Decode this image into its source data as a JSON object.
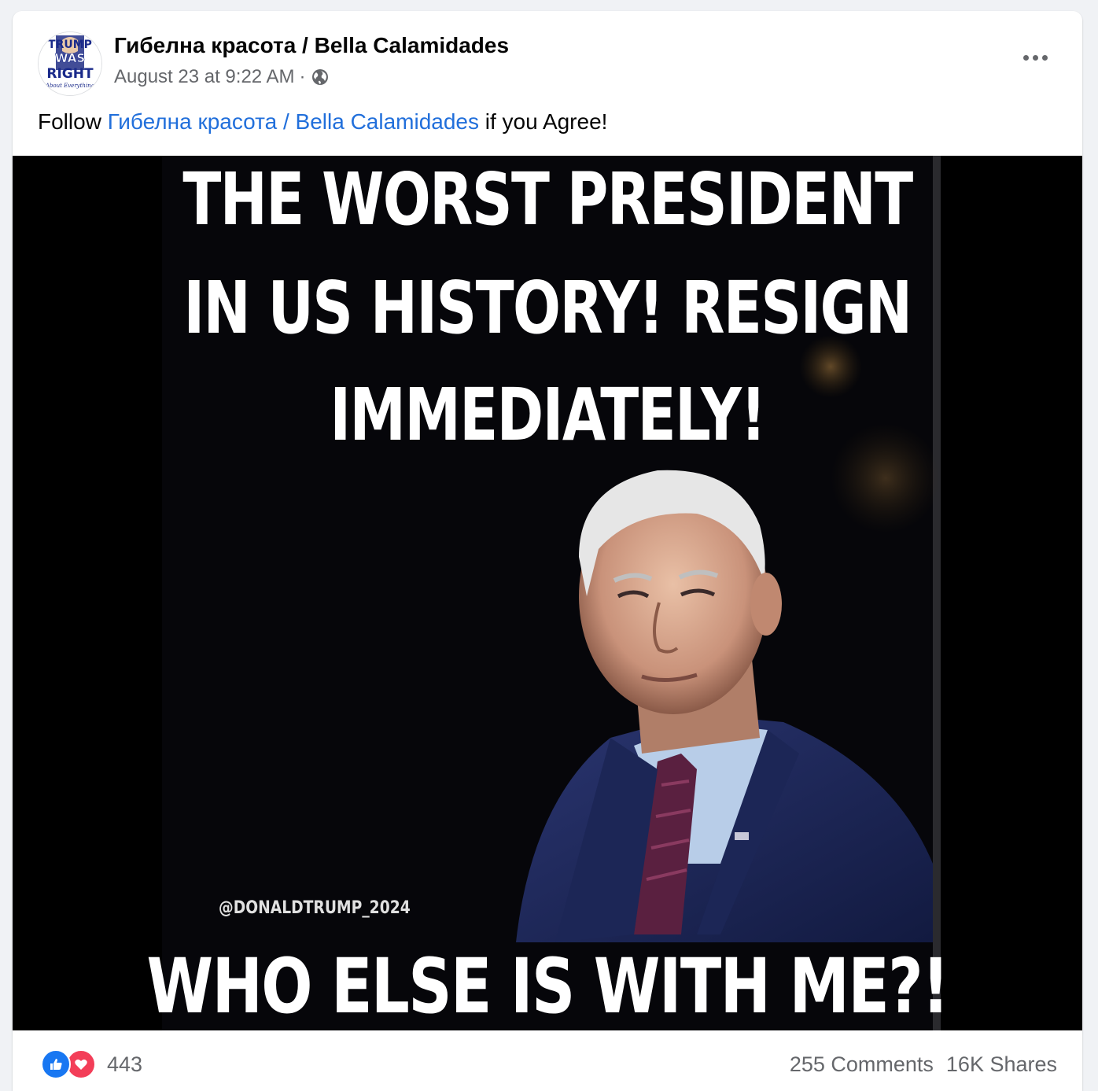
{
  "post": {
    "page_name": "Гибелна красота / Bella Calamidades",
    "timestamp": "August 23 at 9:22 AM",
    "separator": "·",
    "privacy_icon": "globe-icon",
    "more_icon": "more-options-icon",
    "caption": {
      "prefix": "Follow ",
      "link_text": "Гибелна красота / Bella Calamidades",
      "suffix": " if you Agree!"
    },
    "avatar": {
      "text_lines": [
        "TRUMP",
        "WAS",
        "RIGHT"
      ],
      "script_text": "About Everything"
    }
  },
  "meme": {
    "line1": "THE WORST PRESIDENT",
    "line2": "IN US HISTORY! RESIGN",
    "line3": "IMMEDIATELY!",
    "watermark": "@DONALDTRUMP_2024",
    "line4": "WHO ELSE IS WITH ME?!"
  },
  "footer": {
    "reaction_icons": [
      "like-icon",
      "love-icon"
    ],
    "reaction_count": "443",
    "comments": "255 Comments",
    "shares": "16K Shares"
  },
  "colors": {
    "page_bg": "#f0f2f5",
    "link": "#216fdb",
    "secondary_text": "#65676b",
    "like": "#1877f2",
    "love": "#f33e58",
    "suit": "#1f2a5a"
  }
}
